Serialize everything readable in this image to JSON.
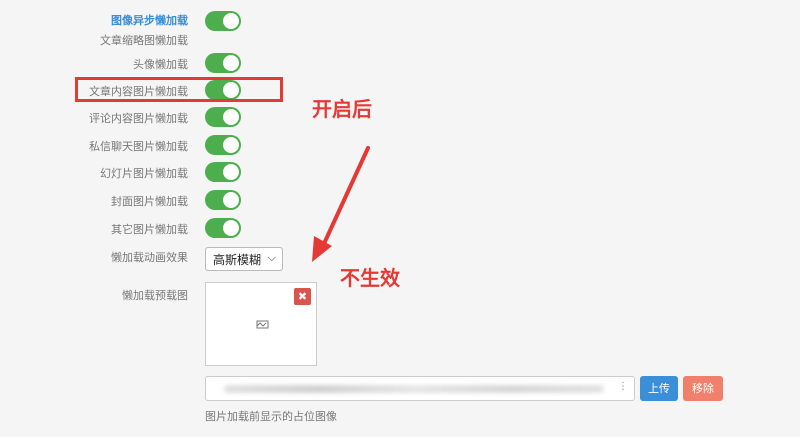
{
  "settings": {
    "heading": "图像异步懒加载",
    "toggles": [
      {
        "label": "文章缩略图懒加载",
        "on": true
      },
      {
        "label": "头像懒加载",
        "on": true
      },
      {
        "label": "文章内容图片懒加载",
        "on": true
      },
      {
        "label": "评论内容图片懒加载",
        "on": true
      },
      {
        "label": "私信聊天图片懒加载",
        "on": true
      },
      {
        "label": "幻灯片图片懒加载",
        "on": true
      },
      {
        "label": "封面图片懒加载",
        "on": true
      },
      {
        "label": "其它图片懒加载",
        "on": true
      }
    ],
    "animation": {
      "label": "懒加载动画效果",
      "value": "高斯模糊"
    },
    "preview": {
      "label": "懒加载预载图",
      "remove_glyph": "✖",
      "hint": "图片加载前显示的占位图像"
    },
    "buttons": {
      "upload": "上传",
      "remove": "移除"
    }
  },
  "annotations": {
    "after_on": "开启后",
    "no_effect": "不生效"
  },
  "colors": {
    "toggle_on": "#4cae4c",
    "highlight": "#e53935",
    "heading": "#3a8fd8",
    "upload": "#3a8fd8",
    "remove": "#f0806c"
  }
}
